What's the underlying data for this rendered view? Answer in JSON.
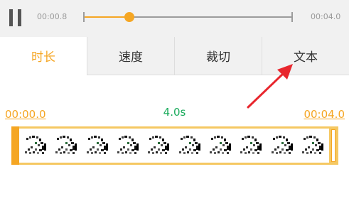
{
  "player": {
    "current_time": "00:00.8",
    "total_time": "00:04.0",
    "progress": 0.22,
    "pause_icon": "pause-icon"
  },
  "tabs": [
    {
      "label": "时长",
      "active": true
    },
    {
      "label": "速度",
      "active": false
    },
    {
      "label": "裁切",
      "active": false
    },
    {
      "label": "文本",
      "active": false
    }
  ],
  "timeline": {
    "start_label": "00:00.0",
    "end_label": "00:04.0",
    "duration": "4.0s",
    "frame_count": 10
  },
  "colors": {
    "accent": "#f5a623",
    "duration_text": "#1aab5c",
    "annotation_arrow": "#e8262d"
  }
}
